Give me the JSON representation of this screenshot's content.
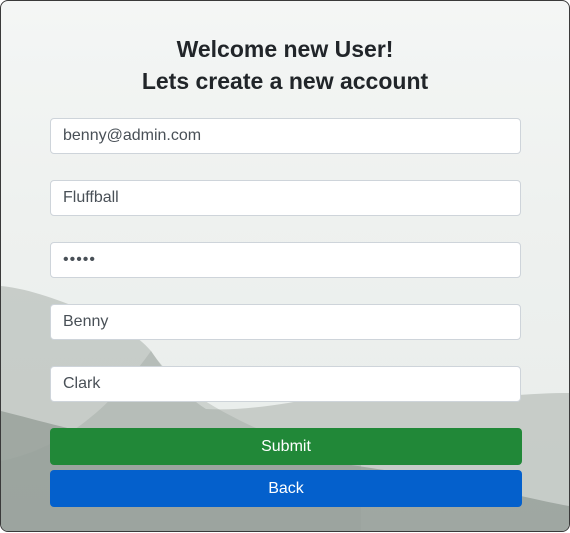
{
  "header": {
    "line1": "Welcome new User!",
    "line2": "Lets create a new account"
  },
  "form": {
    "email_value": "benny@admin.com",
    "username_value": "Fluffball",
    "password_value": "•••••",
    "first_name_value": "Benny",
    "last_name_value": "Clark"
  },
  "buttons": {
    "submit_label": "Submit",
    "back_label": "Back"
  },
  "colors": {
    "submit_bg": "#218838",
    "back_bg": "#0460cc",
    "text": "#212529"
  }
}
